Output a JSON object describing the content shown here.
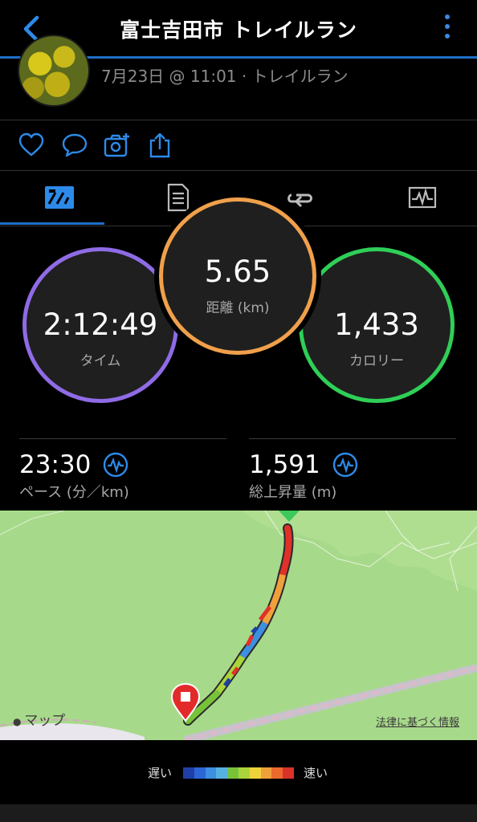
{
  "header": {
    "title": "富士吉田市 トレイルラン"
  },
  "activity": {
    "subtitle": "7月23日 @ 11:01 · トレイルラン"
  },
  "rings": {
    "time": {
      "value": "2:12:49",
      "label": "タイム",
      "color": "#8f6be6"
    },
    "distance": {
      "value": "5.65",
      "label": "距離 (km)",
      "color": "#f0a04b"
    },
    "calories": {
      "value": "1,433",
      "label": "カロリー",
      "color": "#2fcf57"
    }
  },
  "metrics": {
    "pace": {
      "value": "23:30",
      "label": "ペース (分／km)"
    },
    "elevation": {
      "value": "1,591",
      "label": "総上昇量 (m)"
    }
  },
  "map": {
    "credit": "マップ",
    "legal": "法律に基づく情報"
  },
  "legend": {
    "slow": "遅い",
    "fast": "速い",
    "colors": [
      "#1f3fa8",
      "#2b66d4",
      "#3d8fe0",
      "#56b0e0",
      "#78c23a",
      "#a9d43a",
      "#f0d23b",
      "#f0a03b",
      "#ec6a2c",
      "#d8322a"
    ]
  },
  "colors": {
    "accent": "#1d6fc8",
    "route_start": "#3cc85a",
    "route_end": "#e32a2a"
  }
}
